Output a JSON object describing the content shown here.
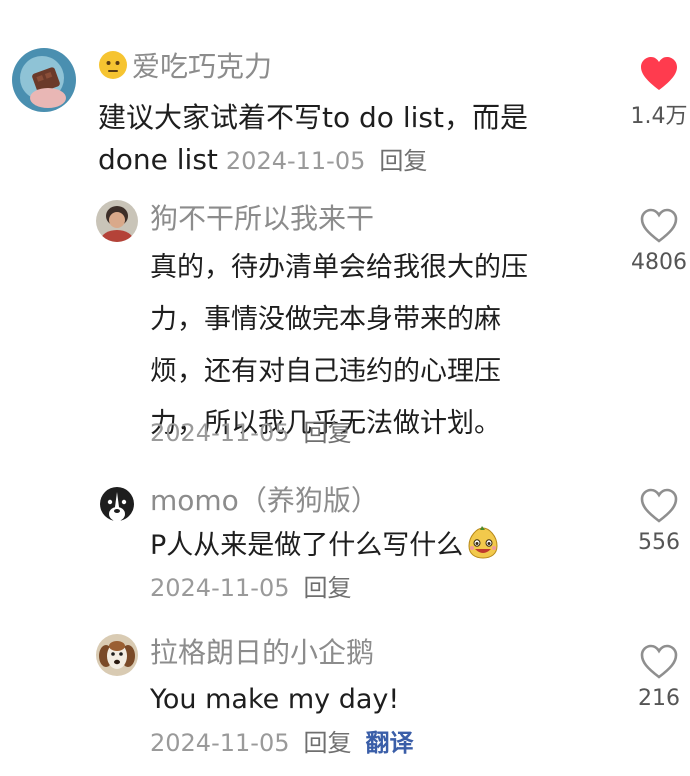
{
  "colors": {
    "like_active": "#ff3b4e",
    "like_inactive": "#9a9a9a",
    "username": "#8c8c8c",
    "text": "#1e1e1e",
    "meta": "#9a9a9a",
    "translate": "#3a5ea8"
  },
  "comments": [
    {
      "username": "爱吃巧克力",
      "username_emoji": "face-neutral-emoji",
      "text_lines": [
        "建议大家试着不写to do list，而是"
      ],
      "text_tail": "done list",
      "date": "2024-11-05",
      "reply_label": "回复",
      "likes": "1.4万",
      "liked": true,
      "avatar_icon": "chocolate-avatar"
    },
    {
      "username": "狗不干所以我来干",
      "text_lines": [
        "真的，待办清单会给我很大的压",
        "力，事情没做完本身带来的麻",
        "烦，还有对自己违约的心理压",
        "力，所以我几乎无法做计划。"
      ],
      "date": "2024-11-05",
      "reply_label": "回复",
      "likes": "4806",
      "liked": false,
      "avatar_icon": "person-avatar"
    },
    {
      "username": "momo（养狗版）",
      "text_lines": [
        "P人从来是做了什么写什么"
      ],
      "text_emoji": "grinning-pear-emoji",
      "date": "2024-11-05",
      "reply_label": "回复",
      "likes": "556",
      "liked": false,
      "avatar_icon": "dog-avatar"
    },
    {
      "username": "拉格朗日的小企鹅",
      "text_lines": [
        "You make my day!"
      ],
      "date": "2024-11-05",
      "reply_label": "回复",
      "translate_label": "翻译",
      "likes": "216",
      "liked": false,
      "avatar_icon": "puppy-avatar"
    }
  ]
}
